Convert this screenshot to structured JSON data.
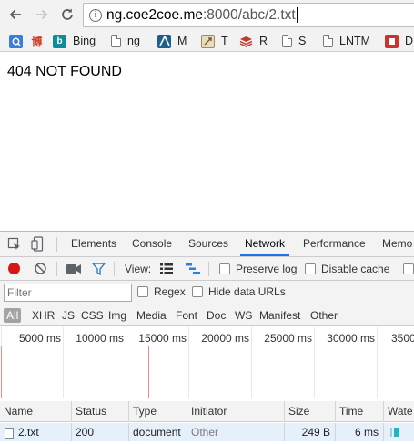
{
  "browser": {
    "back_icon": "back-arrow-icon",
    "forward_icon": "forward-arrow-icon",
    "reload_icon": "reload-icon",
    "url_host": "ng.coe2coe.me",
    "url_rest": ":8000/abc/2.txt",
    "bookmarks": [
      {
        "label": "",
        "icon": "b1",
        "color": "#3b7ddd"
      },
      {
        "label": "",
        "icon": "博",
        "color": "#d13f2b"
      },
      {
        "label": "Bing",
        "icon": "b",
        "color": "#138a97"
      },
      {
        "label": "ng",
        "icon": "page"
      },
      {
        "label": "M",
        "icon": "m",
        "color": "#1f5f8b"
      },
      {
        "label": "T",
        "icon": "t",
        "color": "#c9a45a"
      },
      {
        "label": "R",
        "icon": "r",
        "color": "#c0392b"
      },
      {
        "label": "S",
        "icon": "page"
      },
      {
        "label": "LNTM",
        "icon": "page"
      },
      {
        "label": "D",
        "icon": "d",
        "color": "#d0312d"
      }
    ]
  },
  "page": {
    "text": "404 NOT FOUND"
  },
  "devtools": {
    "tabs": [
      "Elements",
      "Console",
      "Sources",
      "Network",
      "Performance",
      "Memo"
    ],
    "active_tab": "Network",
    "controls": {
      "view_label": "View:",
      "preserve_log_label": "Preserve log",
      "disable_cache_label": "Disable cache"
    },
    "filter": {
      "placeholder": "Filter",
      "value": "",
      "regex_label": "Regex",
      "hide_data_urls_label": "Hide data URLs"
    },
    "type_filters": [
      "All",
      "XHR",
      "JS",
      "CSS",
      "Img",
      "Media",
      "Font",
      "Doc",
      "WS",
      "Manifest",
      "Other"
    ],
    "active_type": "All",
    "timeline_ticks": [
      "5000 ms",
      "10000 ms",
      "15000 ms",
      "20000 ms",
      "25000 ms",
      "30000 ms",
      "3500"
    ],
    "columns": [
      "Name",
      "Status",
      "Type",
      "Initiator",
      "Size",
      "Time",
      "Wate"
    ],
    "rows": [
      {
        "name": "2.txt",
        "status": "200",
        "type": "document",
        "initiator": "Other",
        "size": "249 B",
        "time": "6 ms"
      }
    ],
    "colors": {
      "accent": "#1a73e8",
      "record": "#d91515",
      "filter_icon": "#2f7fd6",
      "waterfall_bar": "#1fb5c3"
    }
  }
}
